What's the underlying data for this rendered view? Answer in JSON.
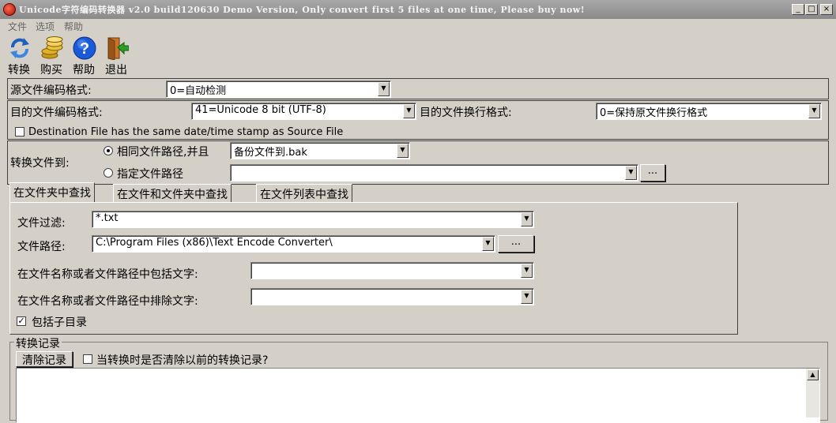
{
  "window": {
    "title": "Unicode字符编码转换器 v2.0 build120630 Demo Version, Only convert first 5 files at one time, Please buy now!",
    "minimize_label": "_",
    "maximize_label": "□",
    "close_label": "×"
  },
  "menu": {
    "file": "文件",
    "options": "选项",
    "help": "帮助"
  },
  "toolbar": {
    "convert": "转换",
    "buy": "购买",
    "help": "帮助",
    "exit": "退出"
  },
  "source_encoding": {
    "label": "源文件编码格式:",
    "value": "0=自动检测"
  },
  "dest_encoding": {
    "label": "目的文件编码格式:",
    "value": "41=Unicode 8 bit (UTF-8)"
  },
  "line_ending": {
    "label": "目的文件换行格式:",
    "value": "0=保持原文件换行格式"
  },
  "timestamp_option": {
    "label": "Destination File has the same date/time stamp as Source File",
    "checked": false
  },
  "convert_to": {
    "label": "转换文件到:",
    "same_path_label": "相同文件路径,并且",
    "backup_value": "备份文件到.bak",
    "custom_path_label": "指定文件路径",
    "custom_path_value": "",
    "browse_label": "..."
  },
  "tabs": [
    {
      "label": "在文件夹中查找"
    },
    {
      "label": "在文件和文件夹中查找"
    },
    {
      "label": "在文件列表中查找"
    }
  ],
  "search": {
    "filter_label": "文件过滤:",
    "filter_value": "*.txt",
    "path_label": "文件路径:",
    "path_value": "C:\\Program Files (x86)\\Text Encode Converter\\",
    "browse_label": "...",
    "include_label": "在文件名称或者文件路径中包括文字:",
    "include_value": "",
    "exclude_label": "在文件名称或者文件路径中排除文字:",
    "exclude_value": "",
    "subdirs_label": "包括子目录",
    "subdirs_checked": true
  },
  "log": {
    "group_label": "转换记录",
    "clear_button": "清除记录",
    "clear_on_convert_label": "当转换时是否清除以前的转换记录?",
    "clear_on_convert_checked": false
  },
  "icons": {
    "app": "app-icon",
    "convert": "refresh-arrows-icon",
    "buy": "coins-icon",
    "help": "question-mark-icon",
    "exit": "door-exit-icon"
  }
}
